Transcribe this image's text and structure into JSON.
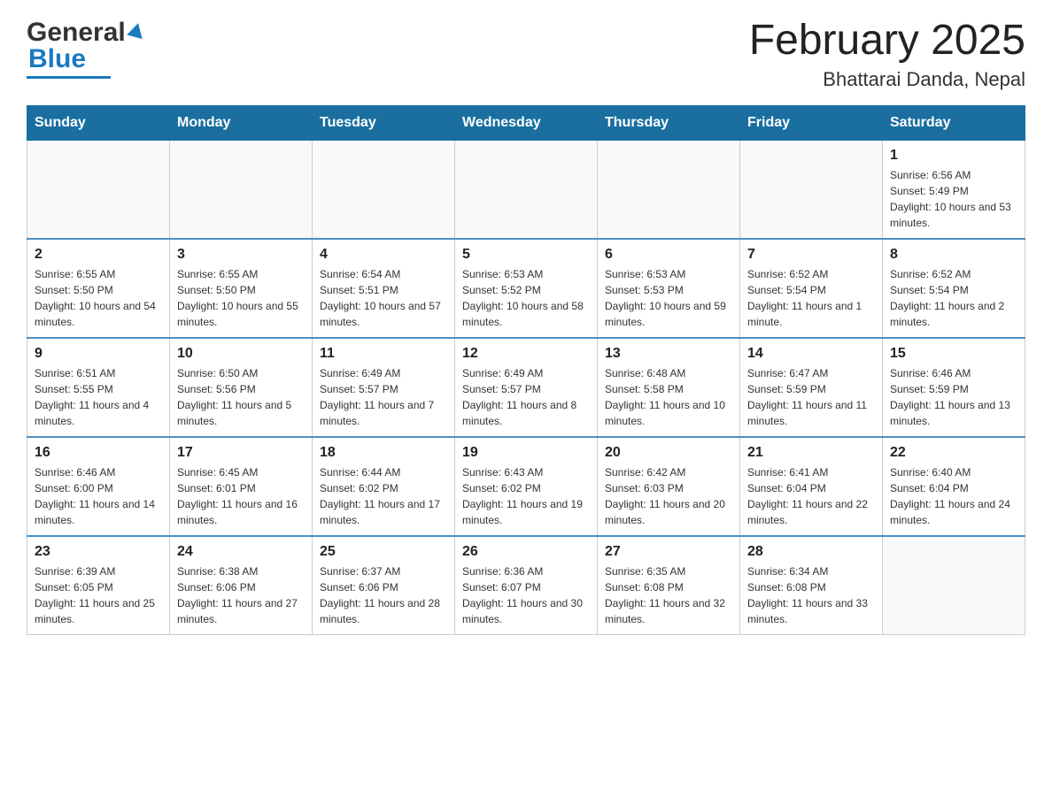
{
  "header": {
    "logo_general": "General",
    "logo_blue": "Blue",
    "month_title": "February 2025",
    "location": "Bhattarai Danda, Nepal"
  },
  "days_of_week": [
    "Sunday",
    "Monday",
    "Tuesday",
    "Wednesday",
    "Thursday",
    "Friday",
    "Saturday"
  ],
  "weeks": [
    [
      {
        "day": "",
        "sunrise": "",
        "sunset": "",
        "daylight": ""
      },
      {
        "day": "",
        "sunrise": "",
        "sunset": "",
        "daylight": ""
      },
      {
        "day": "",
        "sunrise": "",
        "sunset": "",
        "daylight": ""
      },
      {
        "day": "",
        "sunrise": "",
        "sunset": "",
        "daylight": ""
      },
      {
        "day": "",
        "sunrise": "",
        "sunset": "",
        "daylight": ""
      },
      {
        "day": "",
        "sunrise": "",
        "sunset": "",
        "daylight": ""
      },
      {
        "day": "1",
        "sunrise": "Sunrise: 6:56 AM",
        "sunset": "Sunset: 5:49 PM",
        "daylight": "Daylight: 10 hours and 53 minutes."
      }
    ],
    [
      {
        "day": "2",
        "sunrise": "Sunrise: 6:55 AM",
        "sunset": "Sunset: 5:50 PM",
        "daylight": "Daylight: 10 hours and 54 minutes."
      },
      {
        "day": "3",
        "sunrise": "Sunrise: 6:55 AM",
        "sunset": "Sunset: 5:50 PM",
        "daylight": "Daylight: 10 hours and 55 minutes."
      },
      {
        "day": "4",
        "sunrise": "Sunrise: 6:54 AM",
        "sunset": "Sunset: 5:51 PM",
        "daylight": "Daylight: 10 hours and 57 minutes."
      },
      {
        "day": "5",
        "sunrise": "Sunrise: 6:53 AM",
        "sunset": "Sunset: 5:52 PM",
        "daylight": "Daylight: 10 hours and 58 minutes."
      },
      {
        "day": "6",
        "sunrise": "Sunrise: 6:53 AM",
        "sunset": "Sunset: 5:53 PM",
        "daylight": "Daylight: 10 hours and 59 minutes."
      },
      {
        "day": "7",
        "sunrise": "Sunrise: 6:52 AM",
        "sunset": "Sunset: 5:54 PM",
        "daylight": "Daylight: 11 hours and 1 minute."
      },
      {
        "day": "8",
        "sunrise": "Sunrise: 6:52 AM",
        "sunset": "Sunset: 5:54 PM",
        "daylight": "Daylight: 11 hours and 2 minutes."
      }
    ],
    [
      {
        "day": "9",
        "sunrise": "Sunrise: 6:51 AM",
        "sunset": "Sunset: 5:55 PM",
        "daylight": "Daylight: 11 hours and 4 minutes."
      },
      {
        "day": "10",
        "sunrise": "Sunrise: 6:50 AM",
        "sunset": "Sunset: 5:56 PM",
        "daylight": "Daylight: 11 hours and 5 minutes."
      },
      {
        "day": "11",
        "sunrise": "Sunrise: 6:49 AM",
        "sunset": "Sunset: 5:57 PM",
        "daylight": "Daylight: 11 hours and 7 minutes."
      },
      {
        "day": "12",
        "sunrise": "Sunrise: 6:49 AM",
        "sunset": "Sunset: 5:57 PM",
        "daylight": "Daylight: 11 hours and 8 minutes."
      },
      {
        "day": "13",
        "sunrise": "Sunrise: 6:48 AM",
        "sunset": "Sunset: 5:58 PM",
        "daylight": "Daylight: 11 hours and 10 minutes."
      },
      {
        "day": "14",
        "sunrise": "Sunrise: 6:47 AM",
        "sunset": "Sunset: 5:59 PM",
        "daylight": "Daylight: 11 hours and 11 minutes."
      },
      {
        "day": "15",
        "sunrise": "Sunrise: 6:46 AM",
        "sunset": "Sunset: 5:59 PM",
        "daylight": "Daylight: 11 hours and 13 minutes."
      }
    ],
    [
      {
        "day": "16",
        "sunrise": "Sunrise: 6:46 AM",
        "sunset": "Sunset: 6:00 PM",
        "daylight": "Daylight: 11 hours and 14 minutes."
      },
      {
        "day": "17",
        "sunrise": "Sunrise: 6:45 AM",
        "sunset": "Sunset: 6:01 PM",
        "daylight": "Daylight: 11 hours and 16 minutes."
      },
      {
        "day": "18",
        "sunrise": "Sunrise: 6:44 AM",
        "sunset": "Sunset: 6:02 PM",
        "daylight": "Daylight: 11 hours and 17 minutes."
      },
      {
        "day": "19",
        "sunrise": "Sunrise: 6:43 AM",
        "sunset": "Sunset: 6:02 PM",
        "daylight": "Daylight: 11 hours and 19 minutes."
      },
      {
        "day": "20",
        "sunrise": "Sunrise: 6:42 AM",
        "sunset": "Sunset: 6:03 PM",
        "daylight": "Daylight: 11 hours and 20 minutes."
      },
      {
        "day": "21",
        "sunrise": "Sunrise: 6:41 AM",
        "sunset": "Sunset: 6:04 PM",
        "daylight": "Daylight: 11 hours and 22 minutes."
      },
      {
        "day": "22",
        "sunrise": "Sunrise: 6:40 AM",
        "sunset": "Sunset: 6:04 PM",
        "daylight": "Daylight: 11 hours and 24 minutes."
      }
    ],
    [
      {
        "day": "23",
        "sunrise": "Sunrise: 6:39 AM",
        "sunset": "Sunset: 6:05 PM",
        "daylight": "Daylight: 11 hours and 25 minutes."
      },
      {
        "day": "24",
        "sunrise": "Sunrise: 6:38 AM",
        "sunset": "Sunset: 6:06 PM",
        "daylight": "Daylight: 11 hours and 27 minutes."
      },
      {
        "day": "25",
        "sunrise": "Sunrise: 6:37 AM",
        "sunset": "Sunset: 6:06 PM",
        "daylight": "Daylight: 11 hours and 28 minutes."
      },
      {
        "day": "26",
        "sunrise": "Sunrise: 6:36 AM",
        "sunset": "Sunset: 6:07 PM",
        "daylight": "Daylight: 11 hours and 30 minutes."
      },
      {
        "day": "27",
        "sunrise": "Sunrise: 6:35 AM",
        "sunset": "Sunset: 6:08 PM",
        "daylight": "Daylight: 11 hours and 32 minutes."
      },
      {
        "day": "28",
        "sunrise": "Sunrise: 6:34 AM",
        "sunset": "Sunset: 6:08 PM",
        "daylight": "Daylight: 11 hours and 33 minutes."
      },
      {
        "day": "",
        "sunrise": "",
        "sunset": "",
        "daylight": ""
      }
    ]
  ]
}
